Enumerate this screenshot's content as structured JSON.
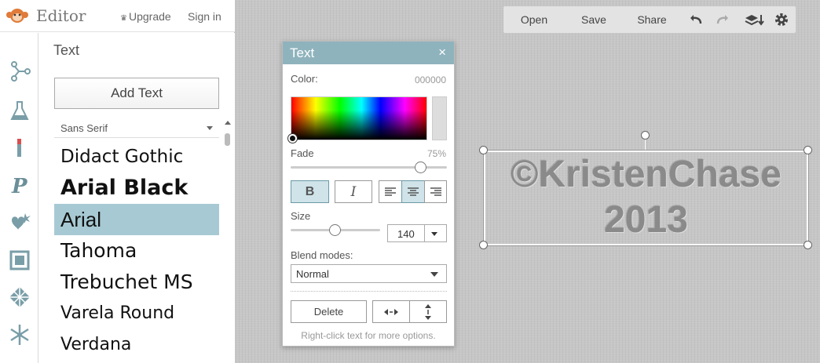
{
  "app": {
    "title": "Editor",
    "upgrade_label": "Upgrade",
    "signin_label": "Sign in"
  },
  "left_tools": [
    "effects-icon",
    "touchup-icon",
    "paint-icon",
    "text-icon",
    "overlays-icon",
    "frames-icon",
    "textures-icon",
    "seasonal-icon"
  ],
  "text_panel": {
    "title": "Text",
    "add_text_label": "Add Text",
    "font_filter": "Sans Serif",
    "fonts": [
      {
        "name": "Didact Gothic",
        "selected": false
      },
      {
        "name": "Arial Black",
        "selected": false
      },
      {
        "name": "Arial",
        "selected": true
      },
      {
        "name": "Tahoma",
        "selected": false
      },
      {
        "name": "Trebuchet MS",
        "selected": false
      },
      {
        "name": "Varela Round",
        "selected": false
      },
      {
        "name": "Verdana",
        "selected": false
      }
    ]
  },
  "toolbar": {
    "open_label": "Open",
    "save_label": "Save",
    "share_label": "Share"
  },
  "text_dialog": {
    "title": "Text",
    "color_label": "Color:",
    "color_value": "000000",
    "fade_label": "Fade",
    "fade_value": "75%",
    "fade": 0.75,
    "bold_label": "B",
    "italic_label": "I",
    "size_label": "Size",
    "size_value": "140",
    "blend_label": "Blend modes:",
    "blend_value": "Normal",
    "delete_label": "Delete",
    "hint": "Right-click text for more options."
  },
  "canvas_text": {
    "line1": "©KristenChase",
    "line2": "2013"
  }
}
